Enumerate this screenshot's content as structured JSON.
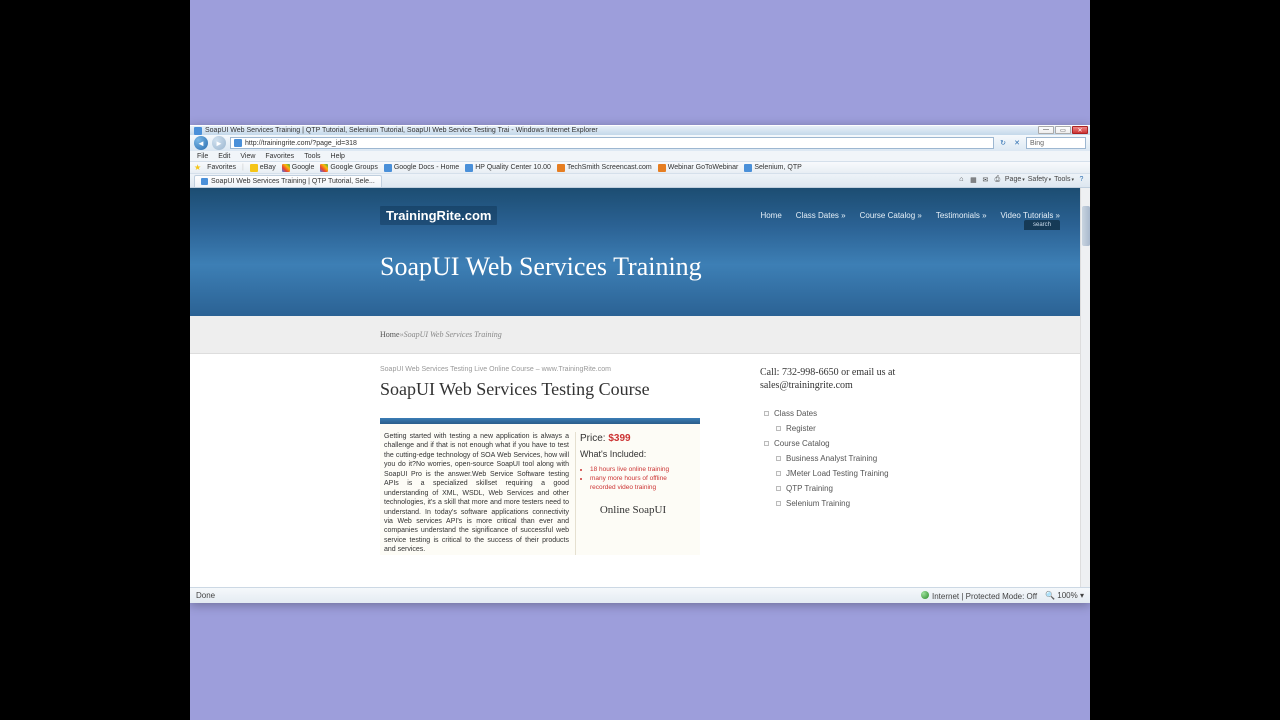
{
  "window": {
    "title": "SoapUI Web Services Training | QTP Tutorial, Selenium Tutorial, SoapUI Web Service Testing Trai - Windows Internet Explorer"
  },
  "nav": {
    "url": "http://trainingrite.com/?page_id=318",
    "search_placeholder": "Bing"
  },
  "menubar": [
    "File",
    "Edit",
    "View",
    "Favorites",
    "Tools",
    "Help"
  ],
  "favbar": {
    "label": "Favorites",
    "items": [
      "eBay",
      "Google",
      "Google Groups",
      "Google Docs - Home",
      "HP Quality Center 10.00",
      "TechSmith Screencast.com",
      "Webinar GoToWebinar",
      "Selenium, QTP"
    ]
  },
  "tabs": {
    "active": "SoapUI Web Services Training | QTP Tutorial, Sele...",
    "tools": [
      "Page",
      "Safety",
      "Tools"
    ]
  },
  "site": {
    "logo": "TrainingRite.com",
    "nav": [
      "Home",
      "Class Dates »",
      "Course Catalog »",
      "Testimonials »",
      "Video Tutorials »"
    ],
    "search": "search",
    "page_title": "SoapUI Web Services Training",
    "breadcrumb": {
      "home": "Home",
      "sep": " » ",
      "current": "SoapUI Web Services Training"
    }
  },
  "article": {
    "pretitle": "SoapUI Web Services Testing Live Online Course – www.TrainingRite.com",
    "title": "SoapUI Web Services Testing Course",
    "desc": "Getting started with testing a new application is always a challenge and if that is not enough what if you have to test the cutting-edge technology of SOA Web Services, how will you do it?No worries, open-source SoapUI tool along with SoapUI Pro is the answer.Web Service Software testing APIs is a specialized skillset requiring a good understanding of XML, WSDL, Web Services and other technologies, it's a skill that more and more testers need to understand. In today's software applications connectivity via Web services API's is more critical than ever and companies understand the significance of successful web service testing is critical to the success of their products and services.",
    "price_label": "Price: ",
    "price_val": "$399",
    "included_label": "What's Included:",
    "bullets": [
      {
        "red": "18 hours live online training"
      },
      {
        "red": "many more hours of offline recorded video training"
      }
    ],
    "online_sub": "Online SoapUI"
  },
  "sidebar": {
    "contact": "Call: 732-998-6650 or email us at sales@trainingrite.com",
    "menu": [
      {
        "label": "Class Dates",
        "indent": 0
      },
      {
        "label": "Register",
        "indent": 1
      },
      {
        "label": "Course Catalog",
        "indent": 0
      },
      {
        "label": "Business Analyst Training",
        "indent": 1
      },
      {
        "label": "JMeter Load Testing Training",
        "indent": 1
      },
      {
        "label": "QTP Training",
        "indent": 1
      },
      {
        "label": "Selenium Training",
        "indent": 1
      }
    ]
  },
  "status": {
    "left": "Done",
    "protected": "Internet | Protected Mode: Off",
    "zoom": "100%"
  }
}
